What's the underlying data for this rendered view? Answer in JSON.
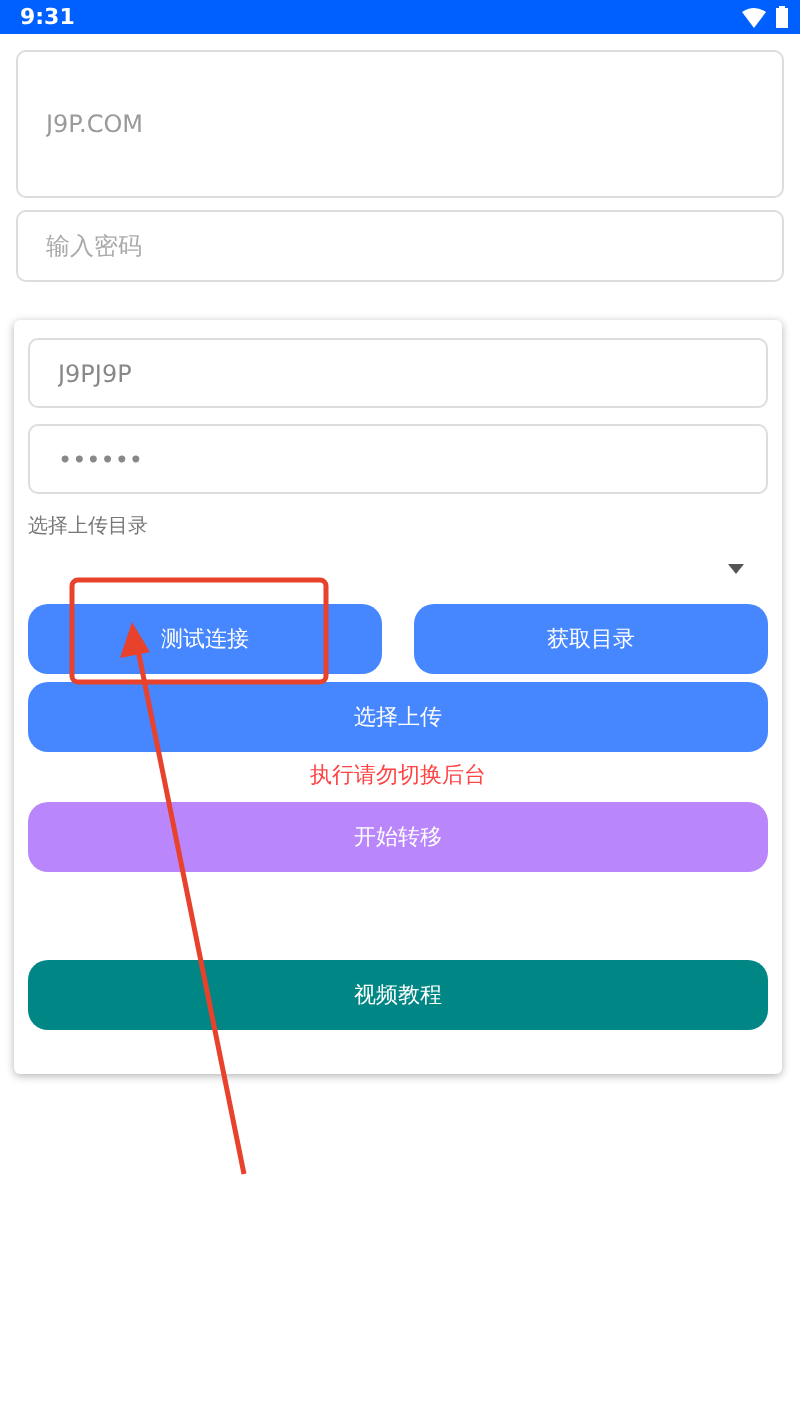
{
  "status_bar": {
    "time": "9:31"
  },
  "server_field": {
    "value": "J9P.COM"
  },
  "password_field": {
    "placeholder": "输入密码"
  },
  "card": {
    "username": {
      "value": "J9PJ9P"
    },
    "password": {
      "value": "••••••"
    },
    "directory_label": "选择上传目录",
    "row_buttons": [
      {
        "label": "测试连接",
        "color": "#4687ff"
      },
      {
        "label": "获取目录",
        "color": "#4687ff"
      }
    ],
    "upload_button": {
      "label": "选择上传",
      "color": "#4687ff"
    },
    "warning": "执行请勿切换后台",
    "transfer_button": {
      "label": "开始转移",
      "color": "#b987fb"
    },
    "tutorial_button": {
      "label": "视频教程",
      "color": "#008785"
    }
  }
}
